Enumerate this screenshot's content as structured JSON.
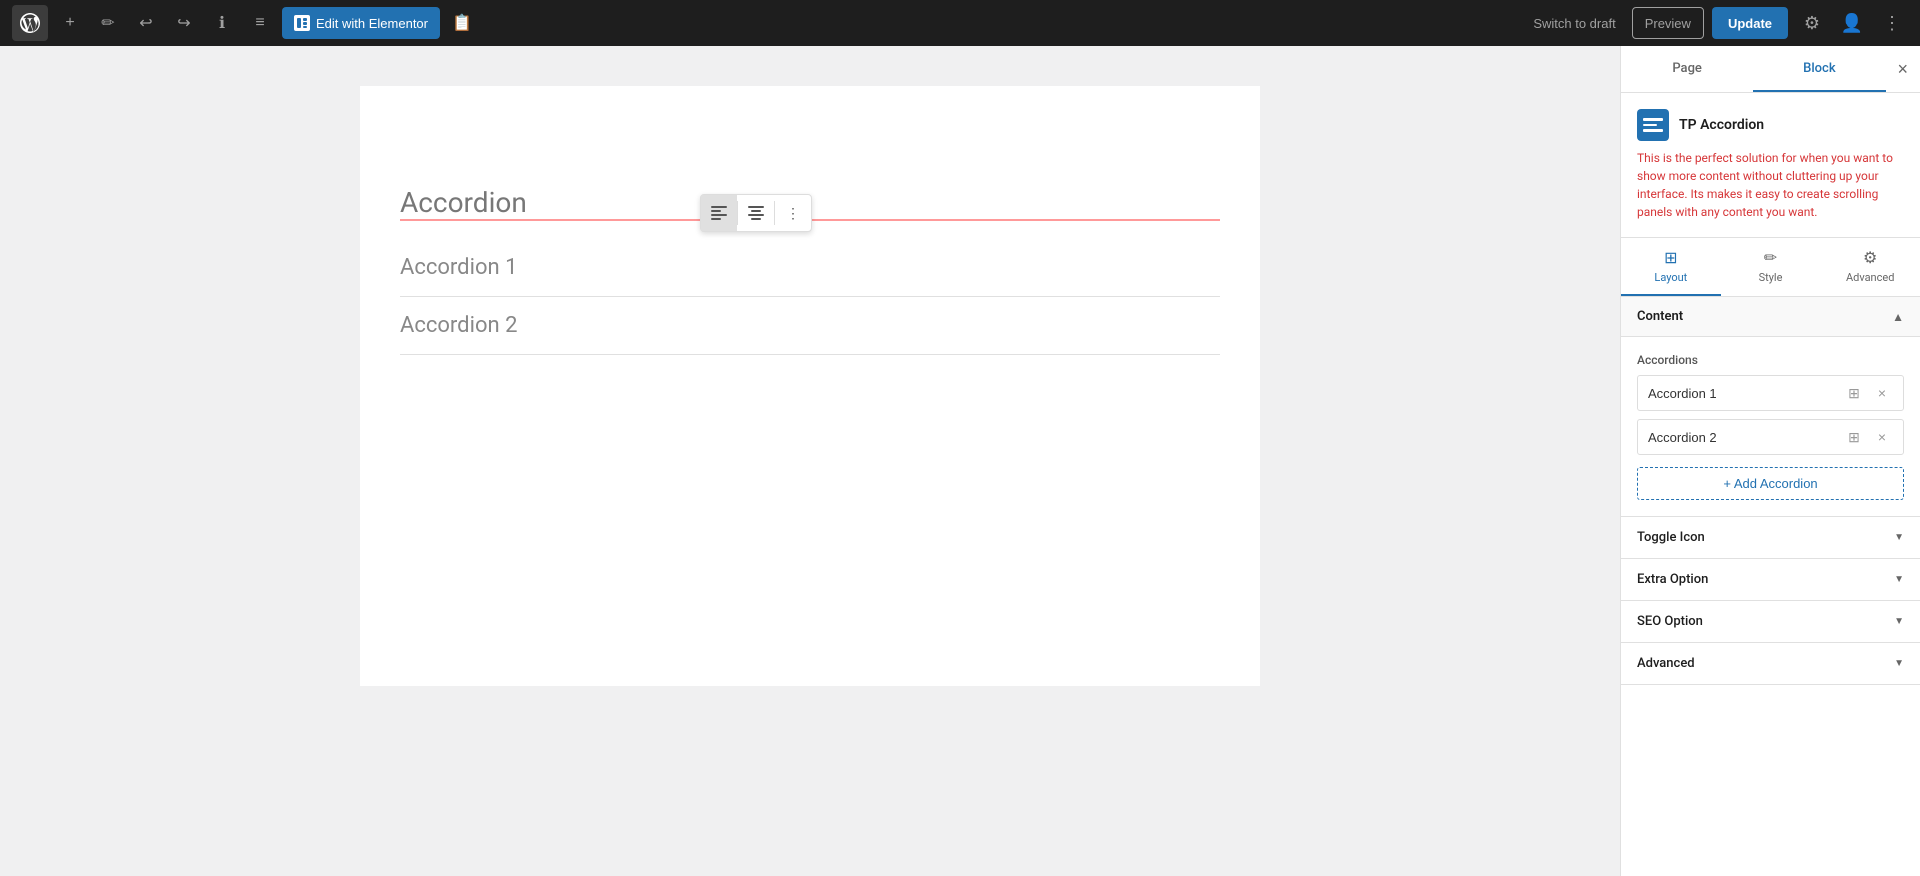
{
  "toolbar": {
    "add_label": "+",
    "edit_label": "✏",
    "undo_label": "↩",
    "redo_label": "↪",
    "info_label": "ℹ",
    "list_label": "≡",
    "elementor_label": "Edit with Elementor",
    "clipboard_label": "📋",
    "switch_draft_label": "Switch to draft",
    "preview_label": "Preview",
    "update_label": "Update",
    "settings_label": "⚙",
    "more_label": "⋮"
  },
  "panel": {
    "page_tab": "Page",
    "block_tab": "Block",
    "close_icon": "×",
    "block_name": "TP Accordion",
    "block_description": "This is the perfect solution for when you want to show more content without cluttering up your interface. Its makes it easy to create scrolling panels with any content you want.",
    "layout_tab": "Layout",
    "style_tab": "Style",
    "advanced_tab": "Advanced",
    "content_section_title": "Content",
    "accordions_label": "Accordions",
    "accordion_1_value": "Accordion 1",
    "accordion_2_value": "Accordion 2",
    "add_accordion_label": "+ Add Accordion",
    "toggle_icon_section": "Toggle Icon",
    "extra_option_section": "Extra Option",
    "seo_option_section": "SEO Option",
    "advanced_section": "Advanced"
  },
  "canvas": {
    "accordion_title": "Accordion",
    "accordion_1_label": "Accordion 1",
    "accordion_2_label": "Accordion 2"
  }
}
